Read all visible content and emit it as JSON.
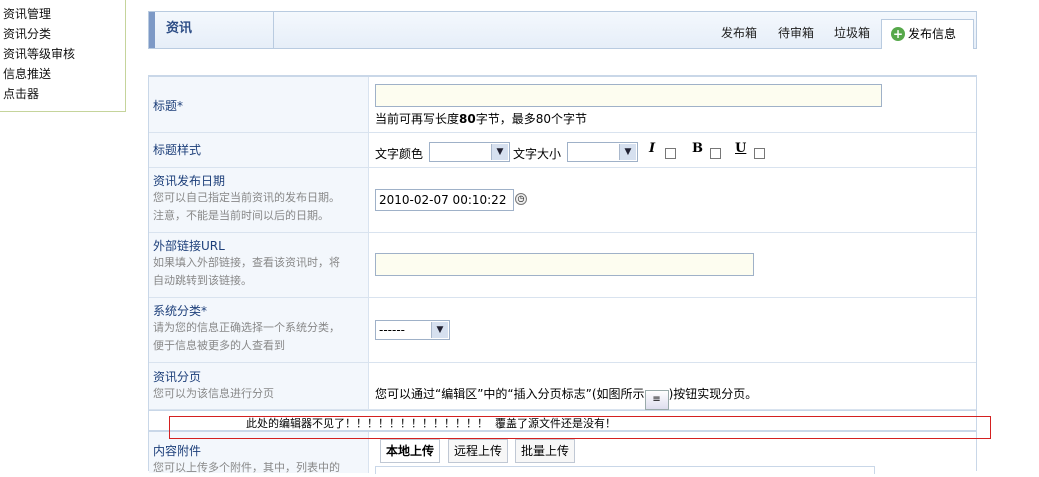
{
  "sidebar": {
    "items": [
      "资讯管理",
      "资讯分类",
      "资讯等级审核",
      "信息推送",
      "点击器"
    ]
  },
  "header": {
    "title": "资讯",
    "tabs": [
      "发布箱",
      "待审箱",
      "垃圾箱"
    ],
    "active_tab": "发布信息",
    "active_tab_icon": "plus-circle-icon"
  },
  "form": {
    "title": {
      "label": "标题*",
      "value": "",
      "hint_prefix": "当前可再写长度",
      "hint_num": "80",
      "hint_suffix": "字节，最多80个字节"
    },
    "style": {
      "label": "标题样式",
      "color_label": "文字颜色",
      "color_value": "",
      "size_label": "文字大小",
      "size_value": "",
      "italic": "I",
      "bold": "B",
      "underline": "U"
    },
    "date": {
      "label": "资讯发布日期",
      "desc1": "您可以自己指定当前资讯的发布日期。",
      "desc2": "注意，不能是当前时间以后的日期。",
      "value": "2010-02-07 00:10:22"
    },
    "url": {
      "label": "外部链接URL",
      "desc1": "如果填入外部链接，查看该资讯时，将",
      "desc2": "自动跳转到该链接。",
      "value": ""
    },
    "category": {
      "label": "系统分类*",
      "desc1": "请为您的信息正确选择一个系统分类，",
      "desc2": "便于信息被更多的人查看到",
      "value": "------"
    },
    "paging": {
      "label": "资讯分页",
      "desc": "您可以为该信息进行分页",
      "text_before": "您可以通过“编辑区”中的“插入分页标志”(如图所示",
      "text_after": ")按钮实现分页。"
    },
    "editor_notice": "此处的编辑器不见了！！！！！！！！！！！！！  覆盖了源文件还是没有！",
    "attachments": {
      "label": "内容附件",
      "desc": "您可以上传多个附件，其中，列表中的",
      "buttons": [
        "本地上传",
        "远程上传",
        "批量上传"
      ]
    }
  }
}
